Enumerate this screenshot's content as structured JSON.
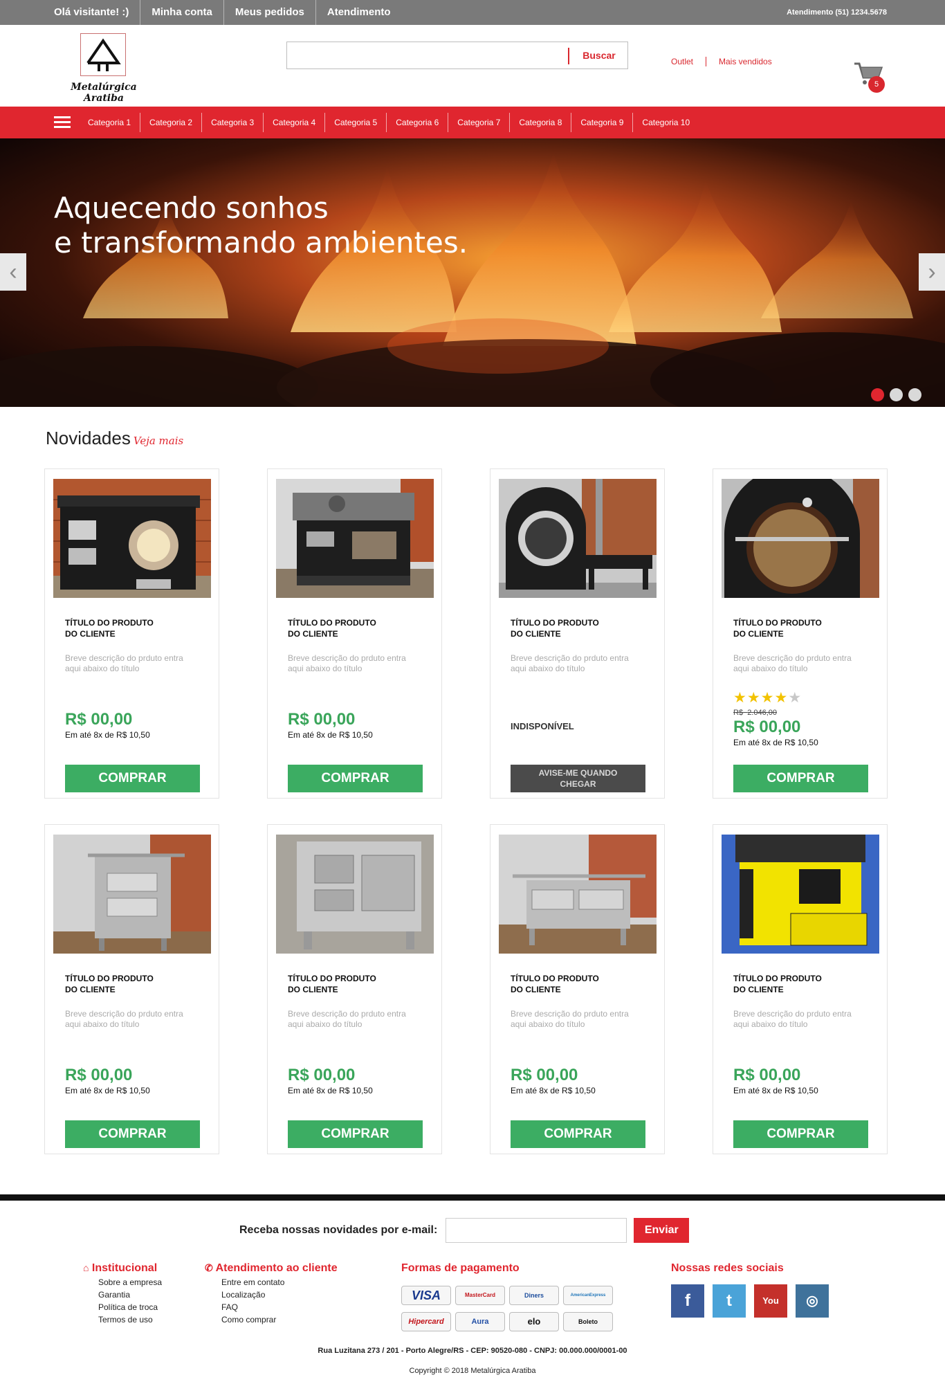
{
  "topbar": {
    "greeting": "Olá visitante! :)",
    "my_account": "Minha conta",
    "my_orders": "Meus pedidos",
    "support": "Atendimento",
    "phone": "Atendimento (51) 1234.5678"
  },
  "header": {
    "logo_text": "Metalúrgica Aratiba",
    "search_placeholder": "",
    "search_button": "Buscar",
    "links": [
      "Outlet",
      "Mais vendidos"
    ],
    "cart_count": "5"
  },
  "nav": {
    "categories": [
      "Categoria 1",
      "Categoria 2",
      "Categoria 3",
      "Categoria 4",
      "Categoria 5",
      "Categoria 6",
      "Categoria 7",
      "Categoria 8",
      "Categoria 9",
      "Categoria 10"
    ]
  },
  "banner": {
    "line1": "Aquecendo sonhos",
    "line2": "e transformando ambientes.",
    "slides": 3,
    "active_slide": 1
  },
  "section": {
    "title": "Novidades",
    "see_more": "Veja mais"
  },
  "products": [
    {
      "title_1": "TÍTULO DO PRODUTO",
      "title_2": "DO CLIENTE",
      "desc_1": "Breve descrição do prduto entra",
      "desc_2": "aqui abaixo do título",
      "price": "R$ 00,00",
      "installments": "Em até 8x de R$ 10,50",
      "button": "COMPRAR",
      "image": "black-stove-round-door"
    },
    {
      "title_1": "TÍTULO DO PRODUTO",
      "title_2": "DO CLIENTE",
      "desc_1": "Breve descrição do prduto entra",
      "desc_2": "aqui abaixo do título",
      "price": "R$ 00,00",
      "installments": "Em até 8x de R$ 10,50",
      "button": "COMPRAR",
      "image": "black-stove-flat-top"
    },
    {
      "title_1": "TÍTULO DO PRODUTO",
      "title_2": "DO CLIENTE",
      "desc_1": "Breve descrição do prduto entra",
      "desc_2": "aqui abaixo do título",
      "status": "INDISPONÍVEL",
      "notify_1": "AVISE-ME QUANDO",
      "notify_2": "CHEGAR",
      "image": "arched-oven-stove"
    },
    {
      "title_1": "TÍTULO DO PRODUTO",
      "title_2": "DO CLIENTE",
      "desc_1": "Breve descrição do prduto entra",
      "desc_2": "aqui abaixo do título",
      "rating": 4,
      "rating_max": 5,
      "old_currency": "R$",
      "old_price": "2.046,00",
      "price": "R$ 00,00",
      "installments": "Em até 8x de R$ 10,50",
      "button": "COMPRAR",
      "image": "arched-oven-close-up"
    },
    {
      "title_1": "TÍTULO DO PRODUTO",
      "title_2": "DO CLIENTE",
      "desc_1": "Breve descrição do prduto entra",
      "desc_2": "aqui abaixo do título",
      "price": "R$ 00,00",
      "installments": "Em até 8x de R$ 10,50",
      "button": "COMPRAR",
      "image": "steel-stove-rail"
    },
    {
      "title_1": "TÍTULO DO PRODUTO",
      "title_2": "DO CLIENTE",
      "desc_1": "Breve descrição do prduto entra",
      "desc_2": "aqui abaixo do título",
      "price": "R$ 00,00",
      "installments": "Em até 8x de R$ 10,50",
      "button": "COMPRAR",
      "image": "steel-stove-front"
    },
    {
      "title_1": "TÍTULO DO PRODUTO",
      "title_2": "DO CLIENTE",
      "desc_1": "Breve descrição do prduto entra",
      "desc_2": "aqui abaixo do título",
      "price": "R$ 00,00",
      "installments": "Em até 8x de R$ 10,50",
      "button": "COMPRAR",
      "image": "steel-stove-wide"
    },
    {
      "title_1": "TÍTULO DO PRODUTO",
      "title_2": "DO CLIENTE",
      "desc_1": "Breve descrição do prduto entra",
      "desc_2": "aqui abaixo do título",
      "price": "R$ 00,00",
      "installments": "Em até 8x de R$ 10,50",
      "button": "COMPRAR",
      "image": "yellow-stove"
    }
  ],
  "footer": {
    "newsletter_label": "Receba nossas novidades por e-mail:",
    "newsletter_button": "Enviar",
    "institutional": {
      "title": "Institucional",
      "items": [
        "Sobre a empresa",
        "Garantia",
        "Política de troca",
        "Termos de uso"
      ]
    },
    "service": {
      "title": "Atendimento ao cliente",
      "items": [
        "Entre em contato",
        "Localização",
        "FAQ",
        "Como comprar"
      ]
    },
    "payment": {
      "title": "Formas de pagamento",
      "methods": [
        "VISA",
        "MasterCard",
        "Diners",
        "AmericanExpress",
        "Hipercard",
        "Aura",
        "elo",
        "Boleto"
      ]
    },
    "social": {
      "title": "Nossas redes sociais",
      "networks": [
        "facebook",
        "twitter",
        "youtube",
        "instagram"
      ]
    },
    "address": "Rua Luzitana 273 / 201 - Porto Alegre/RS - CEP: 90520-080 - CNPJ: 00.000.000/0001-00",
    "copyright": "Copyright © 2018 Metalúrgica Aratiba"
  },
  "colors": {
    "accent": "#e0262f",
    "buy_button": "#3cad63",
    "price": "#3aa55a",
    "topbar": "#7a7a7a"
  }
}
